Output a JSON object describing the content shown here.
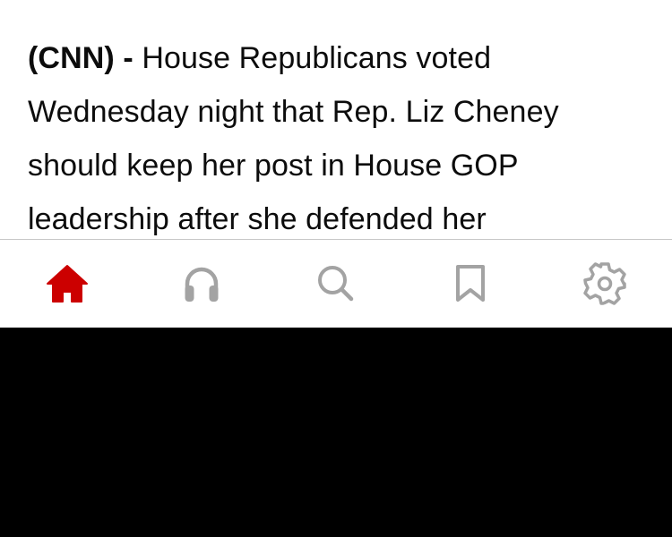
{
  "article": {
    "dateline": "(CNN) -",
    "body_text": "House Republicans voted Wednesday night that Rep. Liz Cheney should keep her post in House GOP leadership after she defended her"
  },
  "tabbar": {
    "active_color": "#cc0000",
    "inactive_color": "#a3a3a3",
    "tabs": [
      {
        "icon": "home-icon",
        "active": true
      },
      {
        "icon": "headphones-icon",
        "active": false
      },
      {
        "icon": "search-icon",
        "active": false
      },
      {
        "icon": "bookmark-icon",
        "active": false
      },
      {
        "icon": "gear-icon",
        "active": false
      }
    ]
  }
}
